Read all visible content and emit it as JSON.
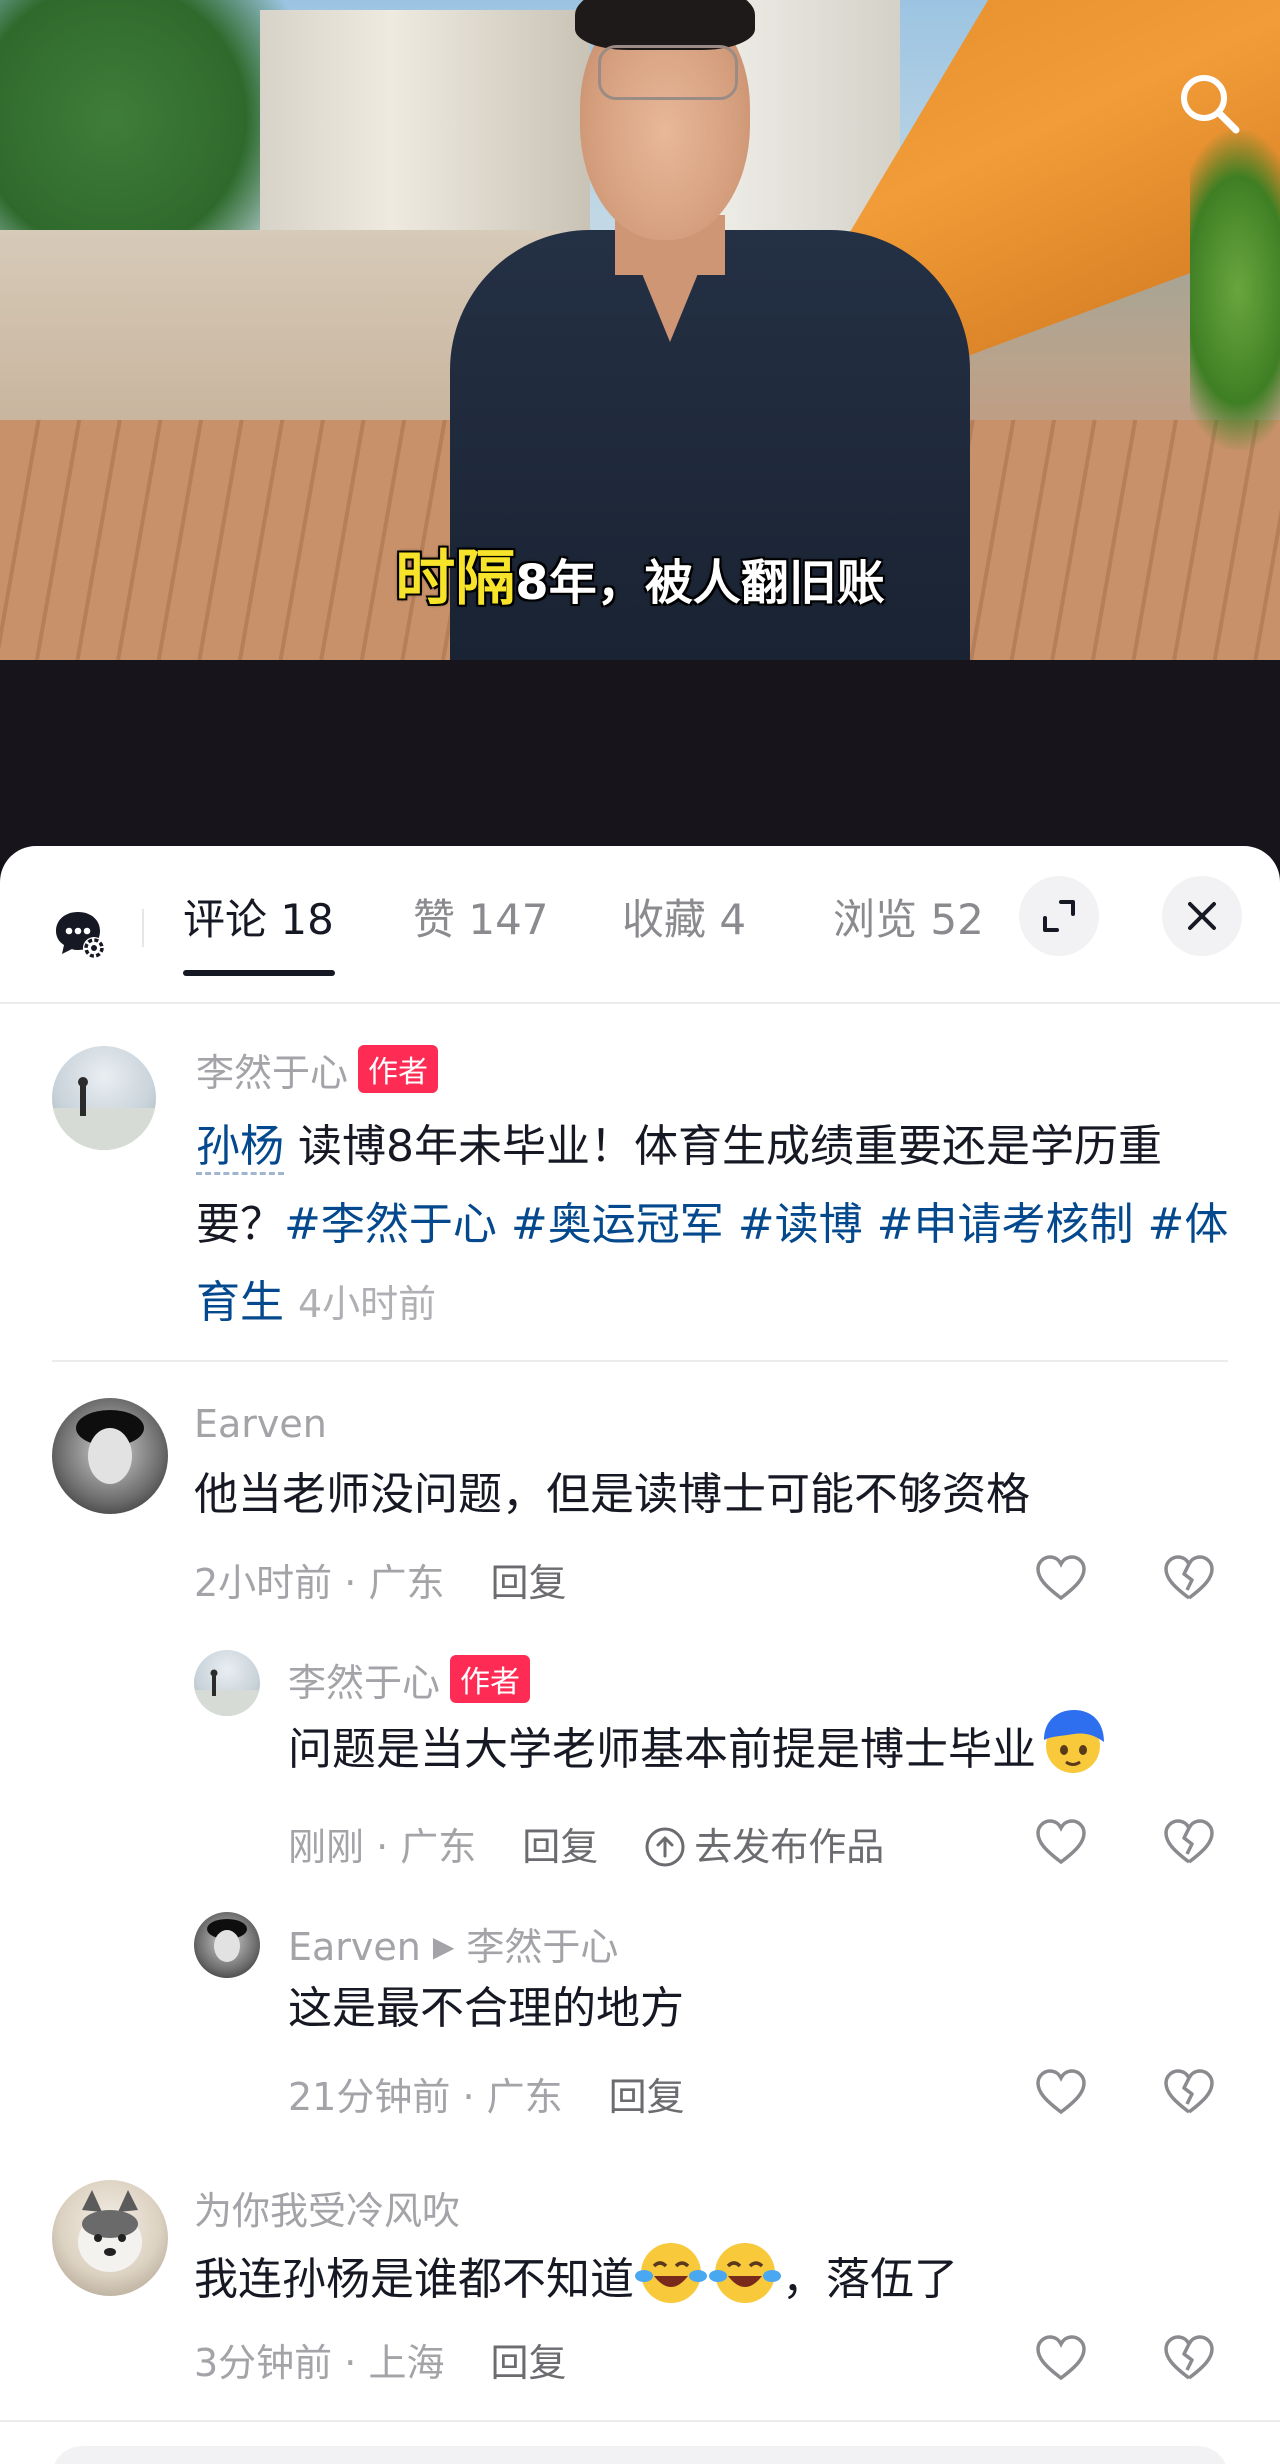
{
  "video": {
    "caption_highlight": "时隔",
    "caption_rest": "8年，被人翻旧账",
    "search_icon": "search-icon"
  },
  "tabs": [
    {
      "label": "评论 18",
      "active": true
    },
    {
      "label": "赞 147",
      "active": false
    },
    {
      "label": "收藏 4",
      "active": false
    },
    {
      "label": "浏览 52",
      "active": false
    }
  ],
  "post": {
    "author": "李然于心",
    "author_badge": "作者",
    "mention": "孙杨",
    "text": " 读博8年未毕业！体育生成绩重要还是学历重要？",
    "hashtags": [
      "#李然于心",
      "#奥运冠军",
      "#读博",
      "#申请考核制",
      "#体育生"
    ],
    "time": "4小时前"
  },
  "comments": [
    {
      "user": "Earven",
      "text": "他当老师没问题，但是读博士可能不够资格",
      "time": "2小时前",
      "location": "广东",
      "reply_label": "回复",
      "replies": [
        {
          "user": "李然于心",
          "badge": "作者",
          "text": "问题是当大学老师基本前提是博士毕业",
          "time": "刚刚",
          "location": "广东",
          "reply_label": "回复",
          "publish_label": "去发布作品"
        },
        {
          "user": "Earven",
          "reply_to": "李然于心",
          "text": "这是最不合理的地方",
          "time": "21分钟前",
          "location": "广东",
          "reply_label": "回复"
        }
      ]
    },
    {
      "user": "为你我受冷风吹",
      "text_before": "我连孙杨是谁都不知道",
      "text_after": "，落伍了",
      "time": "3分钟前",
      "location": "上海",
      "reply_label": "回复"
    }
  ],
  "meta_separator": " · ",
  "colors": {
    "accent_red": "#fe2c55",
    "link_blue": "#04498d",
    "caption_yellow": "#f6e32a"
  }
}
